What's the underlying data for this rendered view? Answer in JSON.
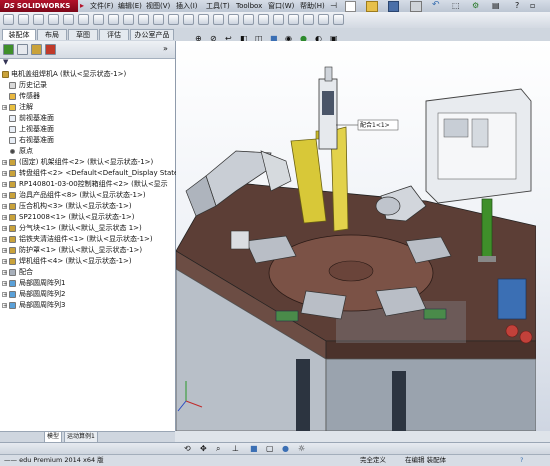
{
  "app": {
    "logo_text": "SOLIDWORKS",
    "logo_prefix": "DS"
  },
  "menu": [
    "文件(F)",
    "编辑(E)",
    "视图(V)",
    "插入(I)",
    "工具(T)",
    "Toolbox",
    "窗口(W)",
    "帮助(H)"
  ],
  "command_tabs": [
    "装配体",
    "布局",
    "草图",
    "评估",
    "办公室产品"
  ],
  "tree": {
    "root": "电机盖组焊机A  (默认<显示状态-1>)",
    "items": [
      {
        "label": "历史记录",
        "icon": "history-icon",
        "indent": 1,
        "expand": ""
      },
      {
        "label": "传感器",
        "icon": "sensor-icon",
        "indent": 1,
        "expand": ""
      },
      {
        "label": "注解",
        "icon": "annotation-icon",
        "indent": 1,
        "expand": "+"
      },
      {
        "label": "前视基准面",
        "icon": "plane-icon",
        "indent": 1,
        "expand": ""
      },
      {
        "label": "上视基准面",
        "icon": "plane-icon",
        "indent": 1,
        "expand": ""
      },
      {
        "label": "右视基准面",
        "icon": "plane-icon",
        "indent": 1,
        "expand": ""
      },
      {
        "label": "原点",
        "icon": "origin-icon",
        "indent": 1,
        "expand": ""
      },
      {
        "label": "(固定) 机架组件<2>  (默认<显示状态-1>)",
        "icon": "part-icon",
        "indent": 1,
        "expand": "+"
      },
      {
        "label": "转盘组件<2>  <Default<Default_Display State-",
        "icon": "assembly-icon",
        "indent": 1,
        "expand": "+"
      },
      {
        "label": "RP140801-03-00控制箱组件<2>  (默认<显示",
        "icon": "assembly-icon",
        "indent": 1,
        "expand": "+"
      },
      {
        "label": "治具产品组件<8>  (默认<显示状态-1>)",
        "icon": "assembly-icon",
        "indent": 1,
        "expand": "+"
      },
      {
        "label": "压合机构<3>  (默认<显示状态-1>)",
        "icon": "assembly-icon",
        "indent": 1,
        "expand": "+"
      },
      {
        "label": "SP21008<1>  (默认<显示状态-1>)",
        "icon": "assembly-icon",
        "indent": 1,
        "expand": "+"
      },
      {
        "label": "分气块<1>  (默认<默认_显示状态 1>)",
        "icon": "assembly-icon",
        "indent": 1,
        "expand": "+"
      },
      {
        "label": "铝铁夹清洁组件<1>  (默认<显示状态-1>)",
        "icon": "assembly-icon",
        "indent": 1,
        "expand": "+"
      },
      {
        "label": "防护罩<1>  (默认<默认_显示状态-1>)",
        "icon": "assembly-icon",
        "indent": 1,
        "expand": "+"
      },
      {
        "label": "焊机组件<4>  (默认<显示状态-1>)",
        "icon": "assembly-icon",
        "indent": 1,
        "expand": "+"
      },
      {
        "label": "配合",
        "icon": "mate-icon",
        "indent": 1,
        "expand": "+"
      },
      {
        "label": "局部圆周阵列1",
        "icon": "pattern-icon",
        "indent": 1,
        "expand": "+"
      },
      {
        "label": "局部圆周阵列2",
        "icon": "pattern-icon",
        "indent": 1,
        "expand": "+"
      },
      {
        "label": "局部圆周阵列3",
        "icon": "pattern-icon",
        "indent": 1,
        "expand": "+"
      }
    ]
  },
  "bottom_tabs": [
    "模型",
    "运动算例1"
  ],
  "viewport": {
    "callout": "配合1<1>"
  },
  "status": {
    "left": "—— edu Premium 2014 x64 版",
    "mid": "完全定义",
    "right": "在编辑 装配体"
  },
  "colors": {
    "brand": "#b3122a",
    "accent_green": "#3f8f2a",
    "machine_yellow": "#d8c838",
    "machine_blue": "#3b6fb4",
    "plate_brown": "#7a4a3c"
  }
}
